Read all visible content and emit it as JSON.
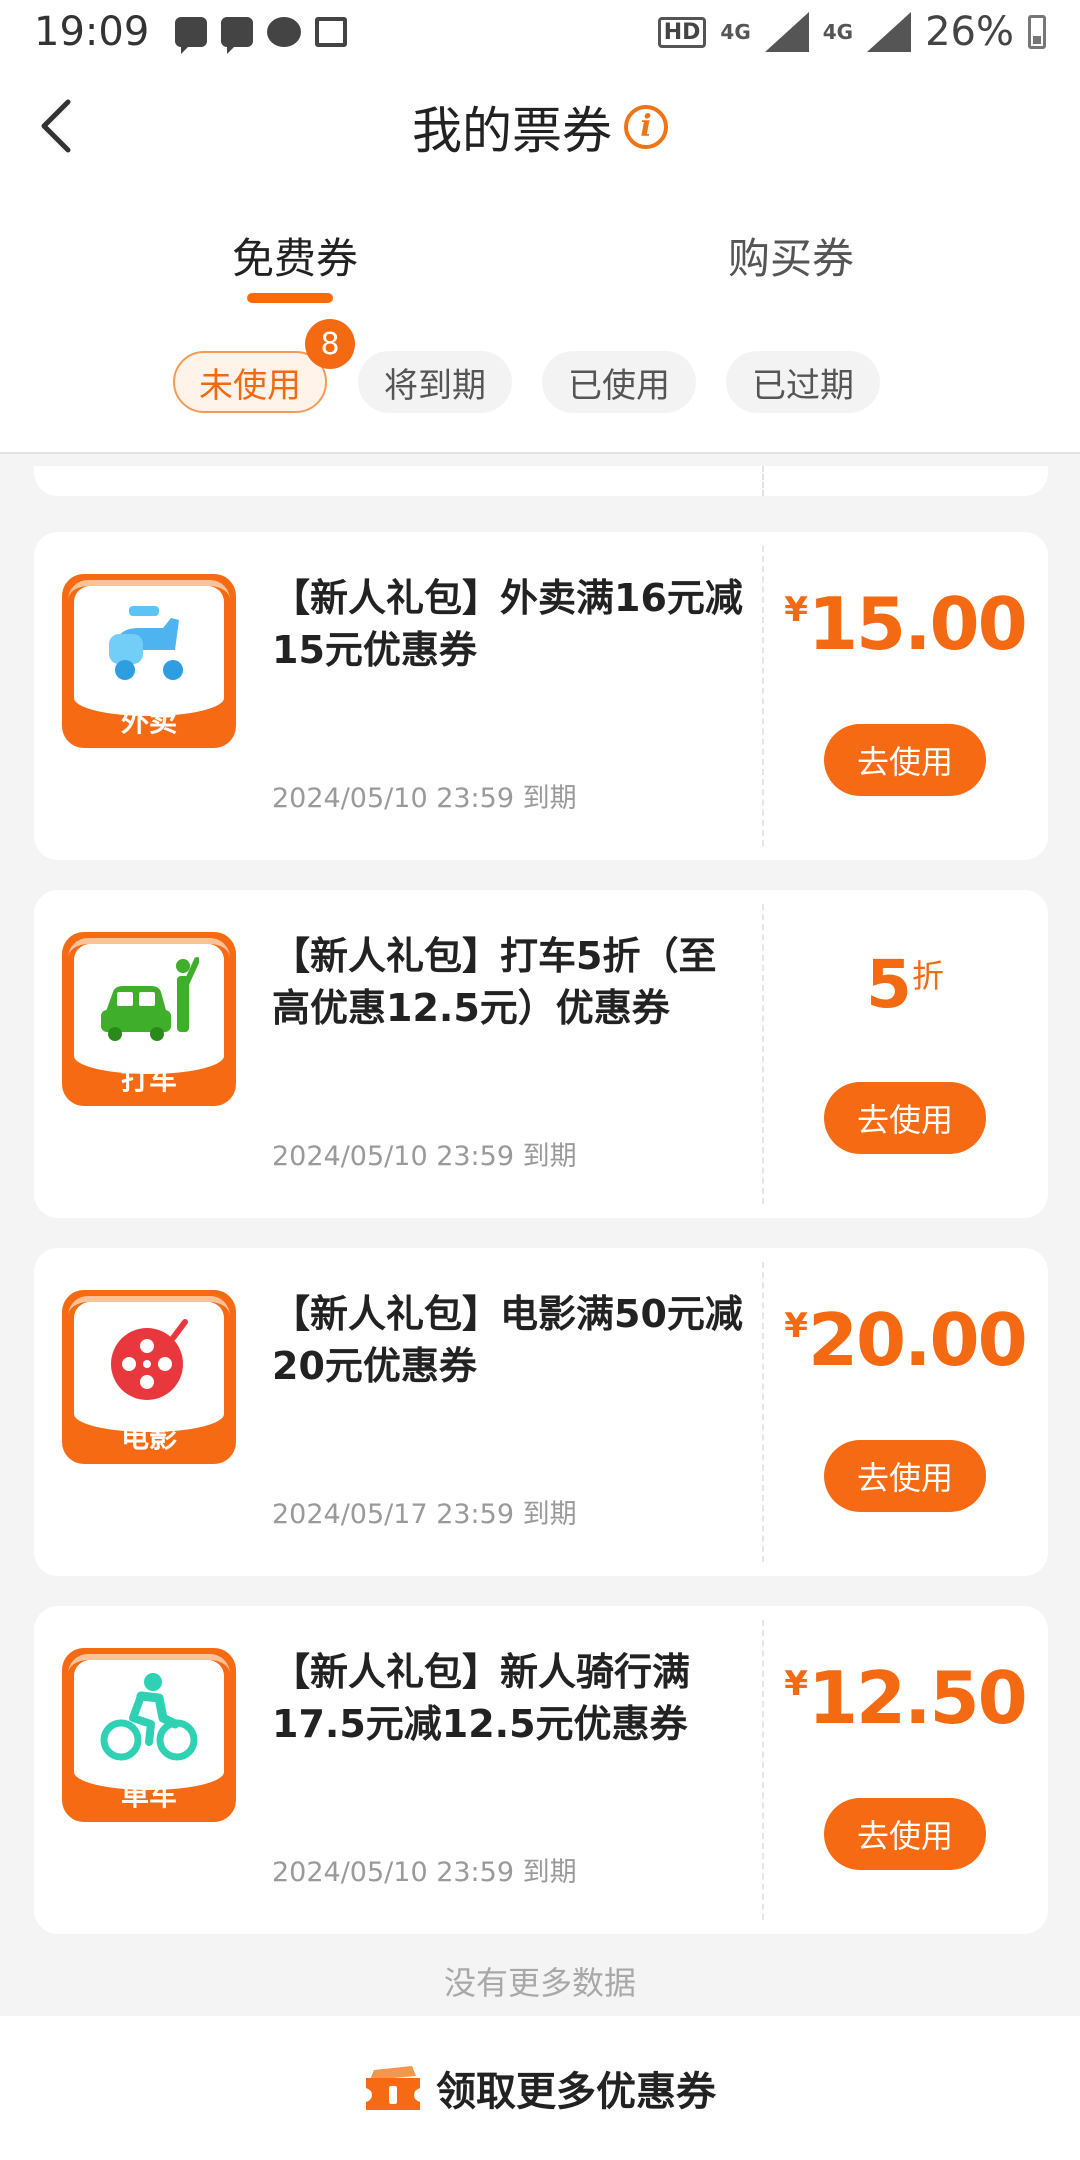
{
  "status_bar": {
    "time": "19:09",
    "hd": "HD",
    "net1": "4G",
    "net2": "4G",
    "battery": "26%"
  },
  "header": {
    "title": "我的票券"
  },
  "tabs": [
    {
      "label": "免费券",
      "active": true
    },
    {
      "label": "购买券",
      "active": false
    }
  ],
  "filters": {
    "badge": "8",
    "items": [
      {
        "label": "未使用",
        "active": true
      },
      {
        "label": "将到期",
        "active": false
      },
      {
        "label": "已使用",
        "active": false
      },
      {
        "label": "已过期",
        "active": false
      }
    ]
  },
  "coupons": [
    {
      "category": "外卖",
      "icon": "scooter-icon",
      "title": "【新人礼包】外卖满16元减15元优惠券",
      "expiry": "2024/05/10 23:59 到期",
      "currency": "¥",
      "value": "15.00",
      "suffix": "",
      "button": "去使用"
    },
    {
      "category": "打车",
      "icon": "taxi-icon",
      "title": "【新人礼包】打车5折（至高优惠12.5元）优惠券",
      "expiry": "2024/05/10 23:59 到期",
      "currency": "",
      "value": "5",
      "suffix": "折",
      "button": "去使用"
    },
    {
      "category": "电影",
      "icon": "film-reel-icon",
      "title": "【新人礼包】电影满50元减20元优惠券",
      "expiry": "2024/05/17 23:59 到期",
      "currency": "¥",
      "value": "20.00",
      "suffix": "",
      "button": "去使用"
    },
    {
      "category": "单车",
      "icon": "bicycle-icon",
      "title": "【新人礼包】新人骑行满17.5元减12.5元优惠券",
      "expiry": "2024/05/10 23:59 到期",
      "currency": "¥",
      "value": "12.50",
      "suffix": "",
      "button": "去使用"
    }
  ],
  "no_more": "没有更多数据",
  "bottom_bar": {
    "label": "领取更多优惠券",
    "icon": "ticket-icon"
  },
  "colors": {
    "accent": "#f56a12",
    "muted": "#9a9a9a"
  }
}
